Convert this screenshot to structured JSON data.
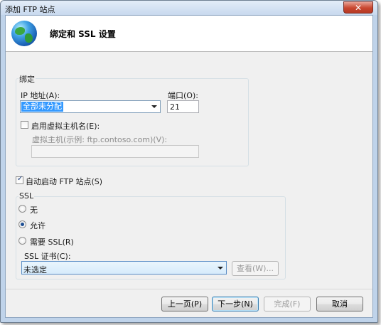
{
  "window": {
    "title": "添加 FTP 站点",
    "close_symbol": "✕"
  },
  "header": {
    "title": "绑定和 SSL 设置",
    "icon": "globe-icon"
  },
  "binding": {
    "group_label": "绑定",
    "ip_label": "IP 地址(A):",
    "ip_value": "全部未分配",
    "port_label": "端口(O):",
    "port_value": "21",
    "virtual_host_checkbox_label": "启用虚拟主机名(E):",
    "virtual_host_checked": false,
    "virtual_host_label": "虚拟主机(示例: ftp.contoso.com)(V):",
    "virtual_host_value": ""
  },
  "auto_start": {
    "label": "自动启动 FTP 站点(S)",
    "checked": true
  },
  "ssl": {
    "group_label": "SSL",
    "options": [
      {
        "label": "无",
        "selected": false
      },
      {
        "label": "允许",
        "selected": true
      },
      {
        "label": "需要 SSL(R)",
        "selected": false
      }
    ],
    "cert_label": "SSL 证书(C):",
    "cert_value": "未选定",
    "view_button": "查看(W)..."
  },
  "footer": {
    "prev_button": "上一页(P)",
    "next_button": "下一步(N)",
    "finish_button": "完成(F)",
    "cancel_button": "取消"
  },
  "colors": {
    "selection": "#3399ff",
    "window_frame": "#bfd3ea",
    "dialog_bg": "#f0f0f0"
  }
}
